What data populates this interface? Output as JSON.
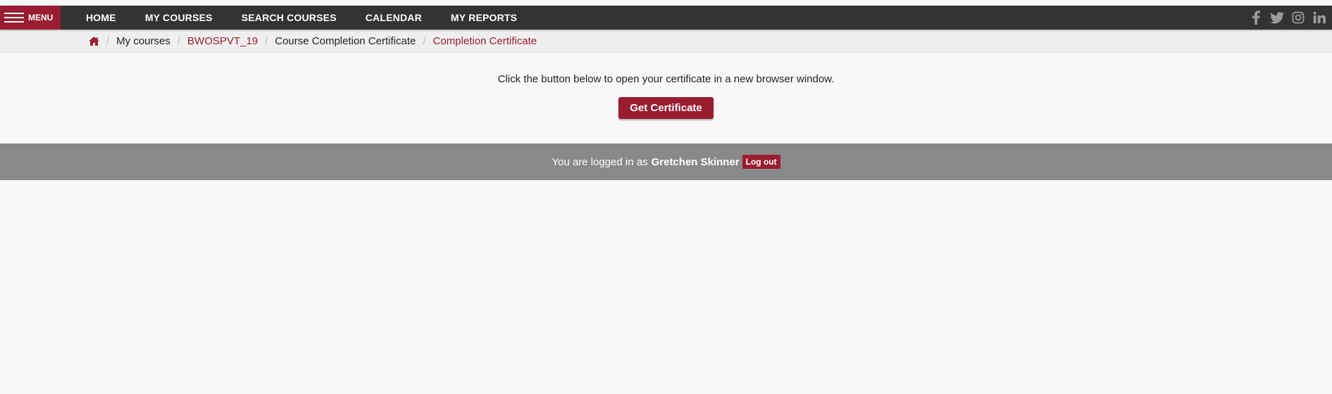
{
  "navbar": {
    "menu_label": "MENU",
    "links": [
      "HOME",
      "MY COURSES",
      "SEARCH COURSES",
      "CALENDAR",
      "MY REPORTS"
    ],
    "social_icons": [
      "facebook-icon",
      "twitter-icon",
      "instagram-icon",
      "linkedin-icon"
    ]
  },
  "breadcrumb": {
    "items": [
      "My courses",
      "BWOSPVT_19",
      "Course Completion Certificate",
      "Completion Certificate"
    ]
  },
  "main": {
    "instruction": "Click the button below to open your certificate in a new browser window.",
    "button_label": "Get Certificate"
  },
  "footer": {
    "logged_in_text": "You are logged in as",
    "user_name": "Gretchen Skinner",
    "logout_label": "Log out"
  },
  "colors": {
    "brand": "#9a1c31",
    "navbar": "#333333",
    "footer": "#898989",
    "background": "#f8f8f8"
  }
}
